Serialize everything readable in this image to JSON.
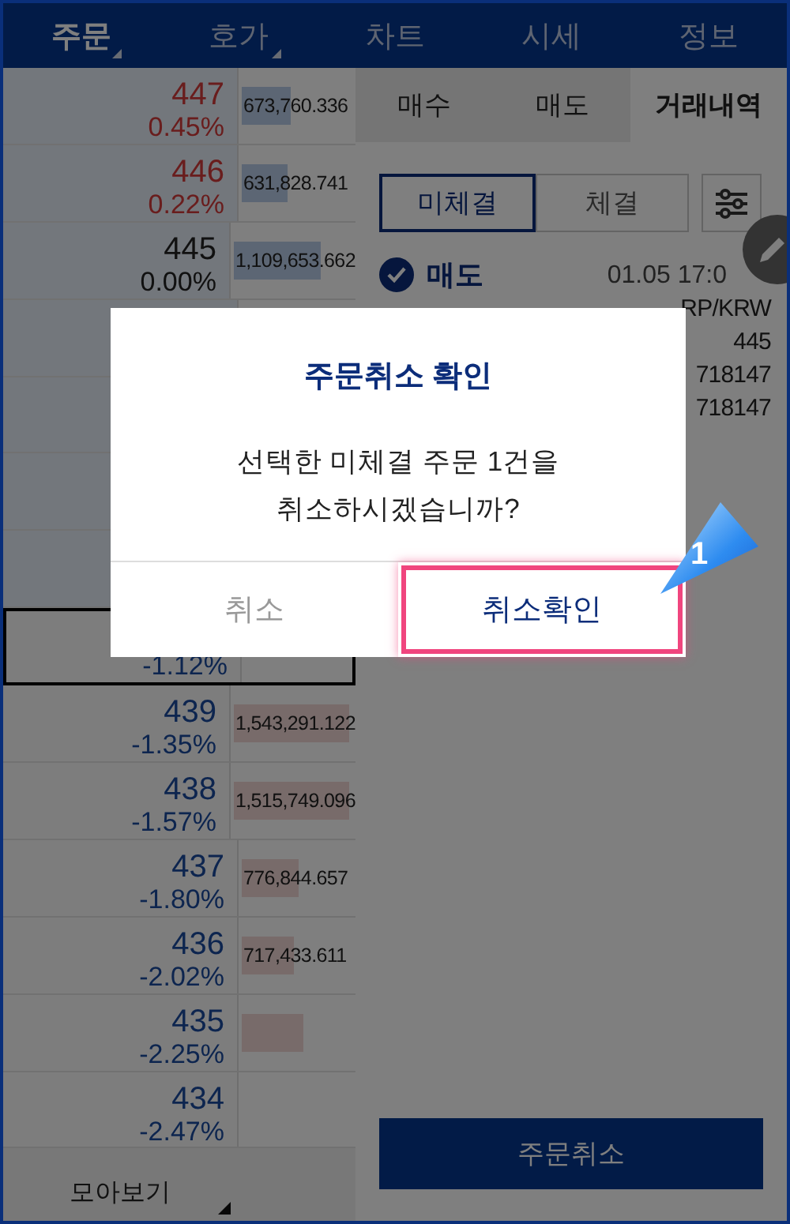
{
  "top_tabs": [
    {
      "label": "주문",
      "selected": true,
      "dropdown": true
    },
    {
      "label": "호가",
      "selected": false,
      "dropdown": true
    },
    {
      "label": "차트",
      "selected": false,
      "dropdown": false
    },
    {
      "label": "시세",
      "selected": false,
      "dropdown": false
    },
    {
      "label": "정보",
      "selected": false,
      "dropdown": false
    }
  ],
  "orderbook": {
    "rows": [
      {
        "kind": "ask",
        "price": "447",
        "change": "0.45%",
        "volume": "673,760.336",
        "level": 0.42,
        "current": false
      },
      {
        "kind": "ask",
        "price": "446",
        "change": "0.22%",
        "volume": "631,828.741",
        "level": 0.39,
        "current": false
      },
      {
        "kind": "even",
        "price": "445",
        "change": "0.00%",
        "volume": "1,109,653.662",
        "level": 0.7,
        "current": false
      },
      {
        "kind": "ask",
        "current": false
      },
      {
        "kind": "ask",
        "current": false
      },
      {
        "kind": "ask",
        "current": false
      },
      {
        "kind": "ask",
        "current": false
      },
      {
        "kind": "bid",
        "change": "-1.12%",
        "current": true
      },
      {
        "kind": "bid",
        "price": "439",
        "change": "-1.35%",
        "volume": "1,543,291.122",
        "level": 1,
        "current": false
      },
      {
        "kind": "bid",
        "price": "438",
        "change": "-1.57%",
        "volume": "1,515,749.096",
        "level": 1,
        "current": false
      },
      {
        "kind": "bid",
        "price": "437",
        "change": "-1.80%",
        "volume": "776,844.657",
        "level": 0.48,
        "current": false
      },
      {
        "kind": "bid",
        "price": "436",
        "change": "-2.02%",
        "volume": "717,433.611",
        "level": 0.44,
        "current": false
      },
      {
        "kind": "bid",
        "price": "435",
        "change": "-2.25%",
        "level": 0.53,
        "current": false
      },
      {
        "kind": "bid",
        "price": "434",
        "change": "-2.47%",
        "current": false
      }
    ],
    "footer_tabs": [
      {
        "label": "모아보기",
        "dropdown": true
      }
    ]
  },
  "panel": {
    "tabs": [
      {
        "label": "매수",
        "selected": false
      },
      {
        "label": "매도",
        "selected": false
      },
      {
        "label": "거래내역",
        "selected": true
      }
    ],
    "filters": [
      {
        "label": "미체결",
        "selected": true
      },
      {
        "label": "체결",
        "selected": false
      }
    ],
    "order": {
      "checked": true,
      "side": "매도",
      "time": "01.05 17:0",
      "market": "RP/KRW",
      "price": "445",
      "quantity": "718147",
      "remaining": "718147"
    },
    "action_button": "주문취소"
  },
  "dialog": {
    "title": "주문취소 확인",
    "message": [
      "선택한 미체결 주문 1건을",
      "취소하시겠습니까?"
    ],
    "buttons": [
      {
        "label": "취소",
        "kind": "cancel",
        "highlighted": false
      },
      {
        "label": "취소확인",
        "kind": "confirm",
        "highlighted": true
      }
    ]
  },
  "callout": {
    "label": "1"
  }
}
